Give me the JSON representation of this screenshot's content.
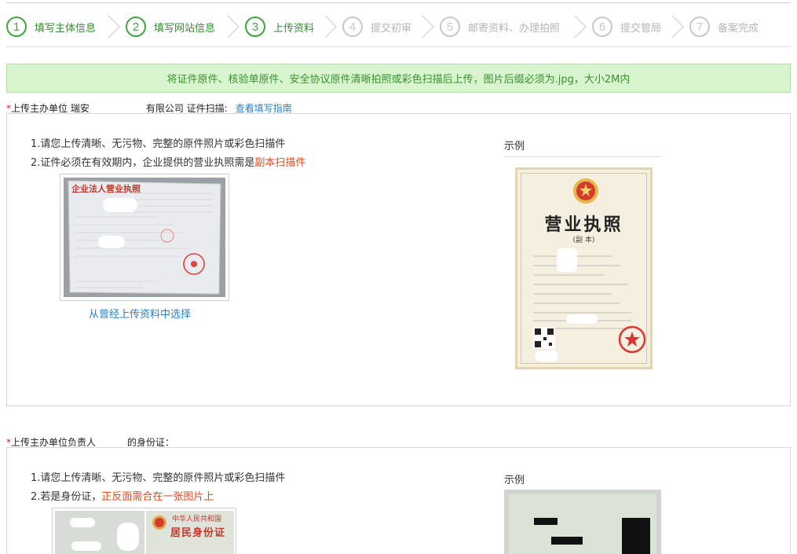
{
  "steps": [
    {
      "num": "1",
      "label": "填写主体信息",
      "state": "done"
    },
    {
      "num": "2",
      "label": "填写网站信息",
      "state": "done"
    },
    {
      "num": "3",
      "label": "上传资料",
      "state": "done"
    },
    {
      "num": "4",
      "label": "提交初审",
      "state": "todo"
    },
    {
      "num": "5",
      "label": "邮寄资料、办理拍照",
      "state": "todo"
    },
    {
      "num": "6",
      "label": "提交管局",
      "state": "todo"
    },
    {
      "num": "7",
      "label": "备案完成",
      "state": "todo"
    }
  ],
  "notice": "将证件原件、核验单原件、安全协议原件清晰拍照或彩色扫描后上传，图片后缀必须为.jpg，大小2M内",
  "section1": {
    "required_mark": "*",
    "label_prefix": "上传主办单位 瑞安",
    "label_suffix": "有限公司 证件扫描:",
    "guide_link": "查看填写指南",
    "instr1": "1.请您上传清晰、无污物、完整的原件照片或彩色扫描件",
    "instr2_prefix": "2.证件必须在有效期内，企业提供的营业执照需是",
    "instr2_highlight": "副本扫描件",
    "choose_link": "从曾经上传资料中选择",
    "example_label": "示例",
    "license_title": "企业法人营业执照",
    "sample_title": "营业执照",
    "sample_subtitle": "(副 本)"
  },
  "section2": {
    "required_mark": "*",
    "label_prefix": "上传主办单位负责人",
    "label_suffix": "的身份证：",
    "instr1": "1.请您上传清晰、无污物、完整的原件照片或彩色扫描件",
    "instr2_prefix": "2.若是身份证，",
    "instr2_highlight": "正反面需合在一张图片上",
    "example_label": "示例",
    "id_title_1": "中华人民共和国",
    "id_title_2": "居民身份证"
  },
  "colors": {
    "done": "#3fa53f",
    "todo": "#c8c8c8",
    "notice_bg": "#d8f5d0",
    "link": "#2b7fc4",
    "highlight": "#e24a1b"
  }
}
